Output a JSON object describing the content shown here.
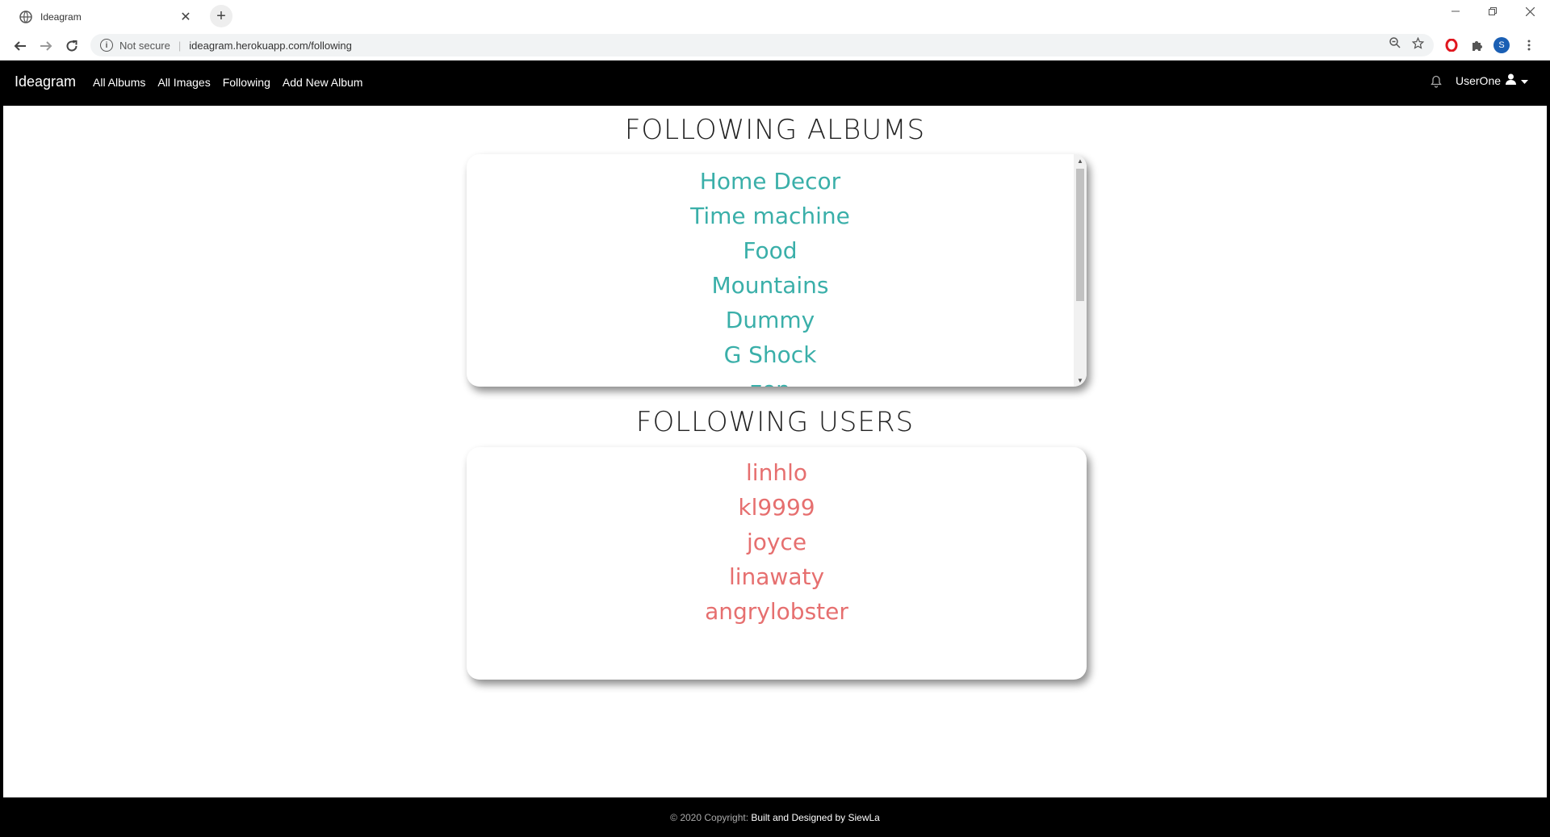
{
  "browser": {
    "tab_title": "Ideagram",
    "tab_close": "✕",
    "new_tab": "+",
    "security_label": "Not secure",
    "url": "ideagram.herokuapp.com/following",
    "profile_initial": "S"
  },
  "navbar": {
    "brand": "Ideagram",
    "links": [
      "All Albums",
      "All Images",
      "Following",
      "Add New Album"
    ],
    "user_name": "UserOne"
  },
  "albums_section": {
    "heading": "FOLLOWING ALBUMS",
    "items": [
      "Home Decor",
      "Time machine",
      "Food",
      "Mountains",
      "Dummy",
      "G Shock",
      "zen"
    ]
  },
  "users_section": {
    "heading": "FOLLOWING USERS",
    "items": [
      "linhlo",
      "kl9999",
      "joyce",
      "linawaty",
      "angrylobster"
    ]
  },
  "footer": {
    "copyright": "© 2020 Copyright:",
    "credit": "Built and Designed by SiewLa"
  },
  "colors": {
    "album_link": "#3aafa9",
    "user_link": "#e66f6f",
    "navbar_bg": "#000000"
  }
}
